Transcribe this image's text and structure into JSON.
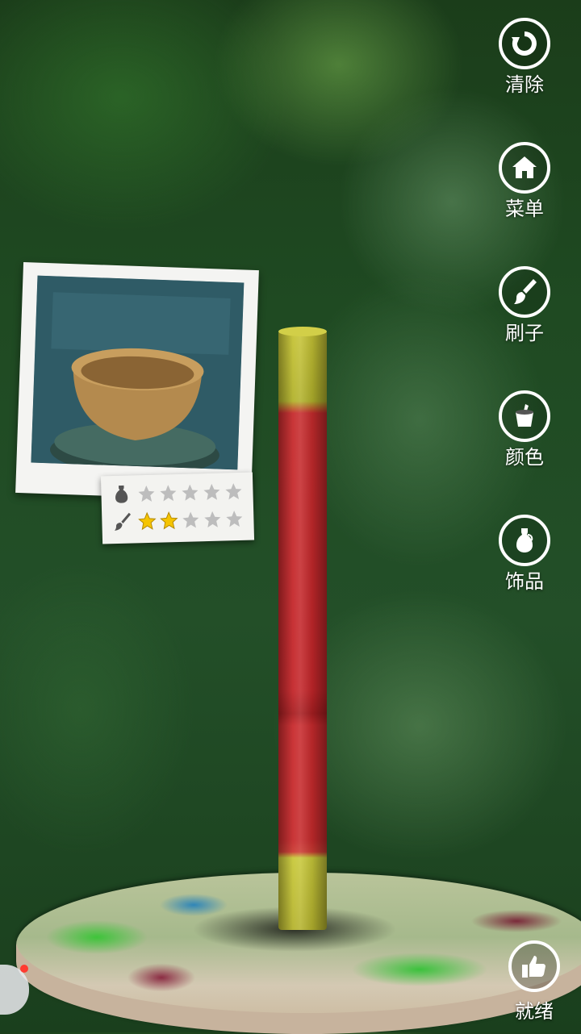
{
  "menu": {
    "items": [
      {
        "label": "清除",
        "icon": "reset-icon"
      },
      {
        "label": "菜单",
        "icon": "home-icon"
      },
      {
        "label": "刷子",
        "icon": "brush-icon"
      },
      {
        "label": "颜色",
        "icon": "paint-bucket-icon"
      },
      {
        "label": "饰品",
        "icon": "vase-icon"
      }
    ]
  },
  "goal_card": {
    "shape_rating": {
      "icon": "vase-icon",
      "stars_filled": 0,
      "stars_total": 5
    },
    "paint_rating": {
      "icon": "brush-icon",
      "stars_filled": 2,
      "stars_total": 5
    }
  },
  "done": {
    "label": "就绪",
    "icon": "thumbs-up-icon"
  },
  "colors": {
    "pole_yellow": "#c7c436",
    "pole_red": "#c62b2d",
    "star_filled": "#f5c400",
    "star_empty": "#b8b8b8"
  }
}
